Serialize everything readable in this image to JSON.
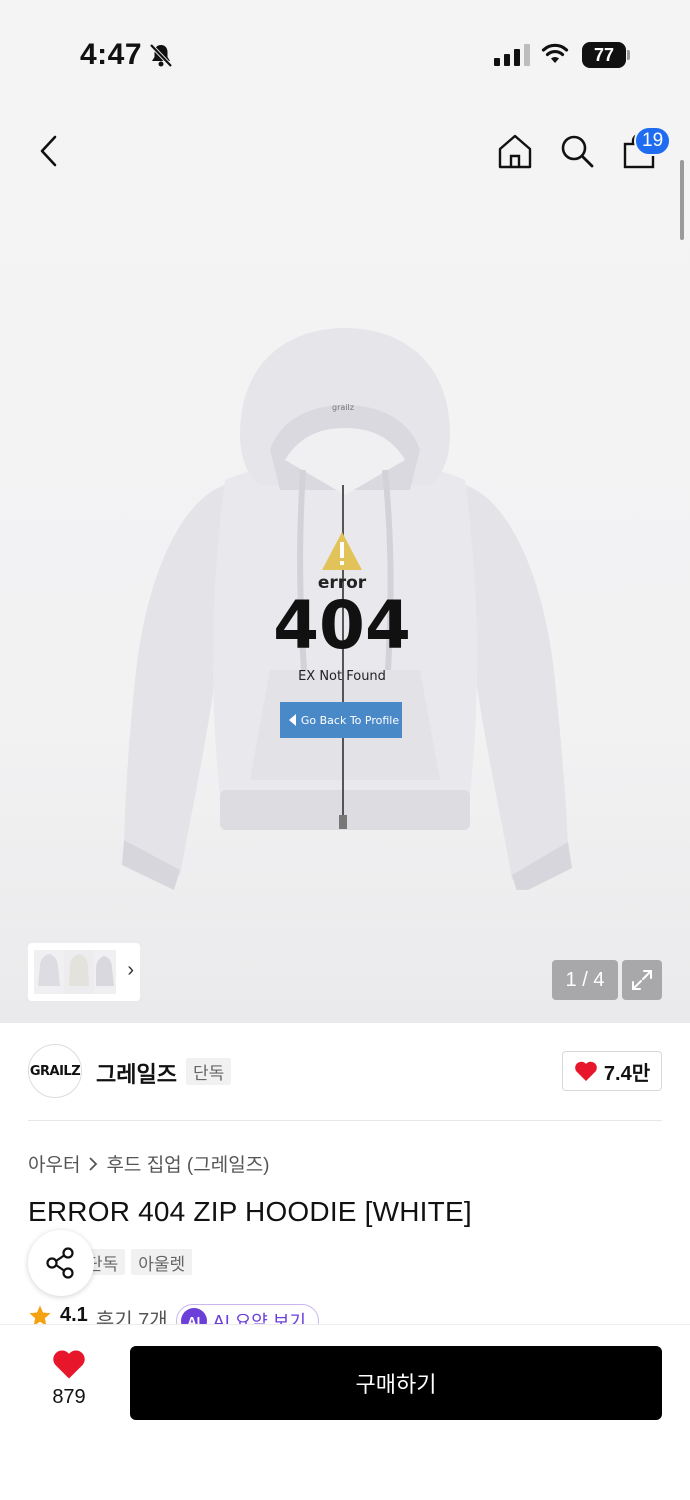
{
  "status_bar": {
    "time": "4:47",
    "battery": "77"
  },
  "nav": {
    "cart_count": "19"
  },
  "gallery": {
    "counter": "1 / 4",
    "print": {
      "error_word": "error",
      "code": "404",
      "subtitle": "EX Not Found",
      "button_text": "Go Back To Profile",
      "neck_label": "grailz"
    }
  },
  "brand": {
    "logo_text": "GRAILZ",
    "name": "그레일즈",
    "tag": "단독",
    "like_count": "7.4만"
  },
  "breadcrumb": {
    "category": "아우터",
    "subcategory": "후드 집업 (그레일즈)"
  },
  "product": {
    "title": "ERROR 404 ZIP HOODIE [WHITE]",
    "tags": [
      "단독",
      "아울렛"
    ],
    "rating": "4.1",
    "reviews": "후기 7개",
    "ai_label": "AI",
    "ai_summary": "AI 요약 보기"
  },
  "bottom": {
    "like_count": "879",
    "buy_label": "구매하기"
  },
  "colors": {
    "accent_blue": "#1f6cf0",
    "heart_red": "#e8162b",
    "ai_purple": "#6b3fd8"
  }
}
